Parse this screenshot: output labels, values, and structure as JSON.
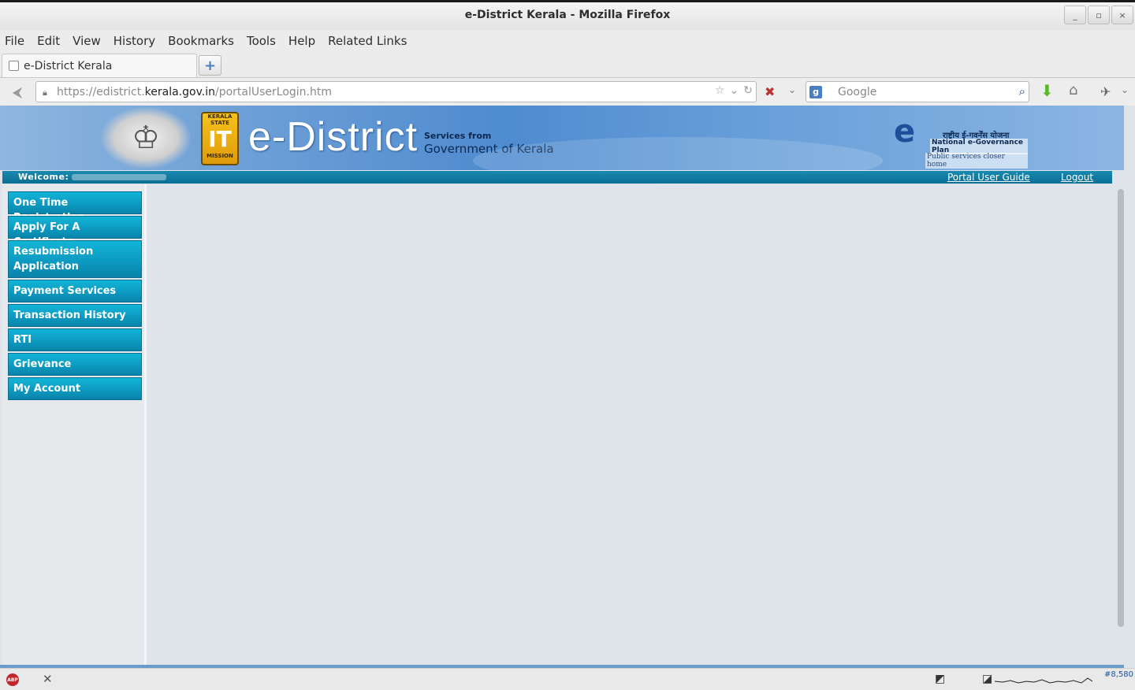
{
  "window": {
    "title": "e-District Kerala - Mozilla Firefox",
    "min": "_",
    "max": "▫",
    "close": "×"
  },
  "menu": [
    "File",
    "Edit",
    "View",
    "History",
    "Bookmarks",
    "Tools",
    "Help",
    "Related Links"
  ],
  "tab": {
    "label": "e-District Kerala",
    "new_tab": "+"
  },
  "nav": {
    "url_prefix": "https://edistrict.",
    "url_host": "kerala.gov.in",
    "url_path": "/portalUserLogin.htm",
    "search_placeholder": "Google",
    "search_engine_icon": "g"
  },
  "banner": {
    "it_top": "KERALA STATE",
    "it_mark": "IT",
    "it_bottom": "MISSION",
    "brand": "e-District",
    "services_from": "Services from",
    "government": "Government of Kerala",
    "negov_hindi": "राष्ट्रीय ई-गवर्नेंस योजना",
    "negov_plan": "National e-Governance Plan",
    "negov_tag": "Public services closer home"
  },
  "welcome": {
    "label": "Welcome:",
    "guide": "Portal User Guide",
    "logout": "Logout"
  },
  "sidebar": {
    "items": [
      {
        "label": "One Time Registration"
      },
      {
        "label": "Apply For A Certificate"
      },
      {
        "label": "Resubmission Application"
      },
      {
        "label": "Payment Services"
      },
      {
        "label": "Transaction History"
      },
      {
        "label": "RTI"
      },
      {
        "label": "Grievance"
      },
      {
        "label": "My Account"
      }
    ]
  },
  "status": {
    "counter": "#8,580"
  }
}
